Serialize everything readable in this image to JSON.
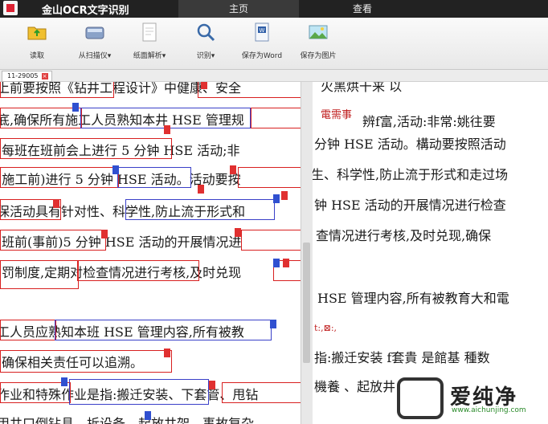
{
  "app": {
    "title": "金山OCR文字识别"
  },
  "tabs": [
    {
      "label": "主页"
    },
    {
      "label": "查看"
    }
  ],
  "toolbar": {
    "read": "读取",
    "scan": "从扫描仪▾",
    "analyze": "纸面解析▾",
    "recognize": "识别▾",
    "save_word": "保存为Word",
    "save_image": "保存为图片"
  },
  "document_tab": {
    "label": "11-29005",
    "close": "×"
  },
  "left_lines": [
    "上前要按照《钻井工程设计》中健康、安全",
    "底,确保所有施工人员熟知本井 HSE 管理规",
    "每班在班前会上进行 5 分钟 HSE 活动;非",
    "(施工前)进行 5 分钟 HSE 活动。活动要按",
    "保活动具有针对性、科学性,防止流于形式和",
    "班前(事前)5 分钟 HSE 活动的开展情况进",
    "罚制度,定期对检查情况进行考核,及时兑现",
    "",
    "工人员应熟知本班 HSE 管理内容,所有被教",
    "确保相关责任可以追溯。",
    "",
    "作业和特殊作业是指:搬迁安装、下套管、甩钻",
    "用井口倒钻具、拆设备、起放井架、事故复杂"
  ],
  "right_lines": [
    {
      "text": "火黑烘干来 以",
      "cls": ""
    },
    {
      "text": "電需事",
      "cls": "red"
    },
    {
      "text": "分钟 HSE 活动。構动要按照活动",
      "cls": ""
    },
    {
      "text": "生、科学性,防止流于形式和走过场",
      "cls": ""
    },
    {
      "text": "钟 HSE 活动的开展情况进行检查",
      "cls": ""
    },
    {
      "text": "查情况进行考核,及时兑现,确保",
      "cls": ""
    },
    {
      "text": "",
      "cls": ""
    },
    {
      "text": "HSE 管理内容,所有被教育大和電",
      "cls": ""
    },
    {
      "text": "t:,⊠:,",
      "cls": "red"
    },
    {
      "text": "指:搬迁安装  f套貴 是館基 種数",
      "cls": ""
    },
    {
      "text": "機養 、起放井",
      "cls": ""
    }
  ],
  "right_side_text": "辨f富,活动:非常:姚往要",
  "watermark": {
    "text": "爱纯净",
    "url": "www.aichunjing.com"
  }
}
